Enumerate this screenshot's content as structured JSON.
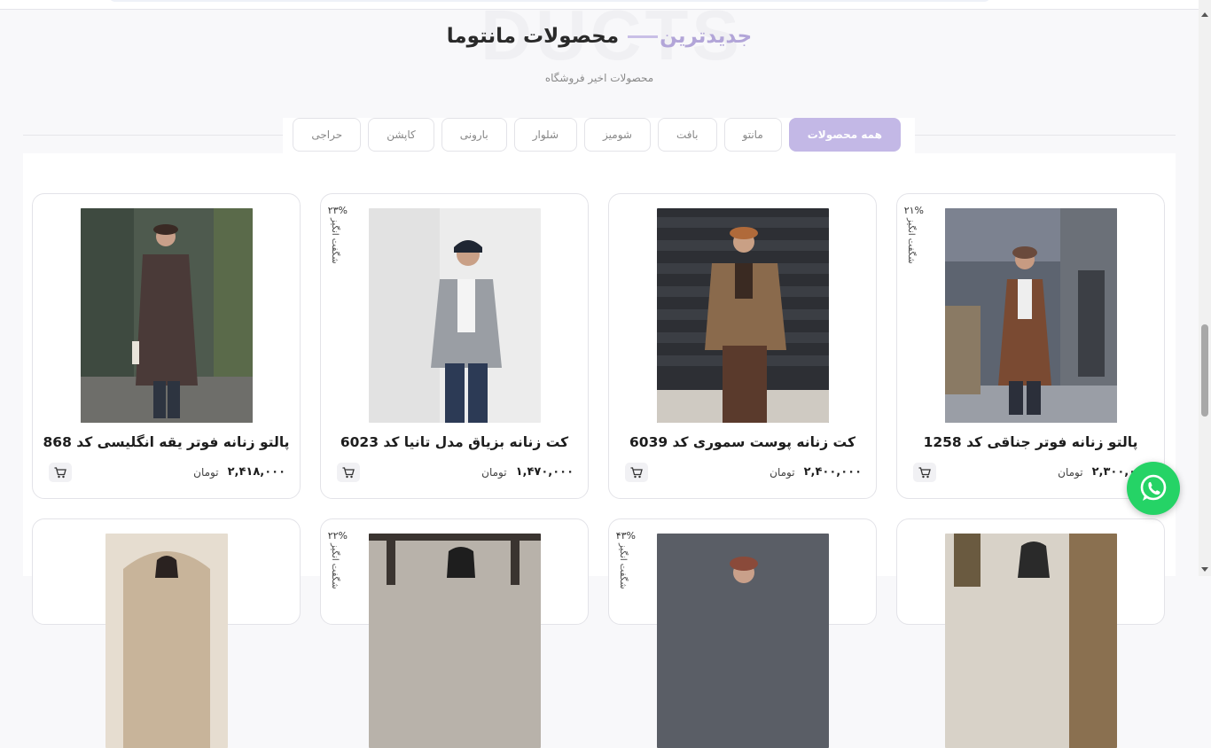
{
  "section": {
    "watermark": "DUCTS",
    "title_accent": "جدیدترین",
    "title_main": "محصولات مانتوما",
    "subtitle": "محصولات اخیر فروشگاه"
  },
  "tabs": [
    {
      "label": "همه محصولات",
      "active": true
    },
    {
      "label": "مانتو",
      "active": false
    },
    {
      "label": "بافت",
      "active": false
    },
    {
      "label": "شومیز",
      "active": false
    },
    {
      "label": "شلوار",
      "active": false
    },
    {
      "label": "بارونی",
      "active": false
    },
    {
      "label": "کاپشن",
      "active": false
    },
    {
      "label": "حراجی",
      "active": false
    }
  ],
  "currency": "تومان",
  "discount_label": "شگفت‌ انگیز",
  "products": [
    {
      "title": "پالتو زنانه فوتر جناقی کد 1258",
      "price": "۲,۳۰۰,۰۰۰",
      "discount": "۲۱%",
      "image_icon": "coat-photo"
    },
    {
      "title": "کت زنانه پوست سموری کد 6039",
      "price": "۲,۴۰۰,۰۰۰",
      "discount": "",
      "image_icon": "fur-jacket-photo"
    },
    {
      "title": "کت زنانه بزیاق مدل تانیا کد 6023",
      "price": "۱,۴۷۰,۰۰۰",
      "discount": "۲۳%",
      "image_icon": "blazer-photo"
    },
    {
      "title": "پالتو زنانه فوتر یقه انگلیسی کد 868",
      "price": "۲,۴۱۸,۰۰۰",
      "discount": "",
      "image_icon": "long-coat-photo"
    }
  ],
  "products_row2": [
    {
      "discount": ""
    },
    {
      "discount": "۴۳%"
    },
    {
      "discount": "۲۲%"
    },
    {
      "discount": ""
    }
  ],
  "colors": {
    "accent": "#c3b8e6",
    "whatsapp": "#25d366"
  }
}
